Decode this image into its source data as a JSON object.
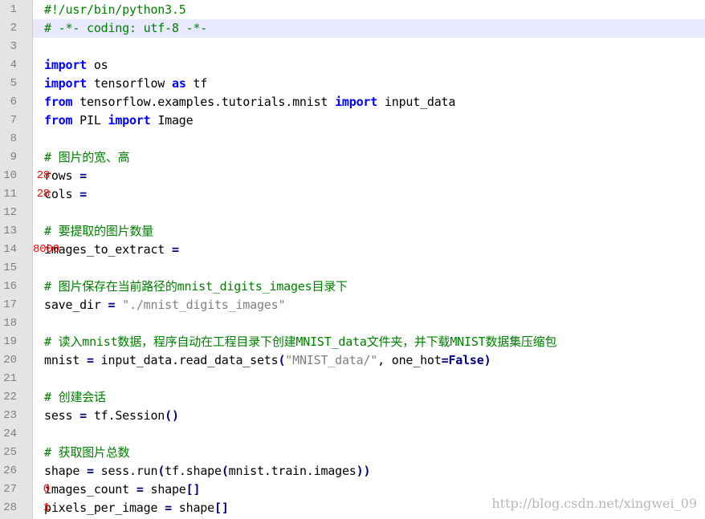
{
  "editor": {
    "lines": [
      {
        "n": "1",
        "tokens": [
          {
            "t": "#!/usr/bin/python3.5",
            "c": "cm"
          }
        ]
      },
      {
        "n": "2",
        "active": true,
        "tokens": [
          {
            "t": "# -*- coding: utf-8 -*-",
            "c": "cm"
          }
        ]
      },
      {
        "n": "3",
        "tokens": []
      },
      {
        "n": "4",
        "tokens": [
          {
            "t": "import",
            "c": "kw"
          },
          {
            "t": " os",
            "c": "id"
          }
        ]
      },
      {
        "n": "5",
        "tokens": [
          {
            "t": "import",
            "c": "kw"
          },
          {
            "t": " tensorflow ",
            "c": "id"
          },
          {
            "t": "as",
            "c": "kw"
          },
          {
            "t": " tf",
            "c": "id"
          }
        ]
      },
      {
        "n": "6",
        "tokens": [
          {
            "t": "from",
            "c": "kw"
          },
          {
            "t": " tensorflow.examples.tutorials.mnist ",
            "c": "id"
          },
          {
            "t": "import",
            "c": "kw"
          },
          {
            "t": " input_data",
            "c": "id"
          }
        ]
      },
      {
        "n": "7",
        "tokens": [
          {
            "t": "from",
            "c": "kw"
          },
          {
            "t": " PIL ",
            "c": "id"
          },
          {
            "t": "import",
            "c": "kw"
          },
          {
            "t": " Image",
            "c": "id"
          }
        ]
      },
      {
        "n": "8",
        "tokens": []
      },
      {
        "n": "9",
        "tokens": [
          {
            "t": "# 图片的宽、高",
            "c": "cm"
          }
        ]
      },
      {
        "n": "10",
        "tokens": [
          {
            "t": "rows ",
            "c": "id"
          },
          {
            "t": "=",
            "c": "op"
          },
          {
            "t": " ",
            "c": "id"
          },
          {
            "t": "28",
            "c": "num"
          }
        ]
      },
      {
        "n": "11",
        "tokens": [
          {
            "t": "cols ",
            "c": "id"
          },
          {
            "t": "=",
            "c": "op"
          },
          {
            "t": " ",
            "c": "id"
          },
          {
            "t": "28",
            "c": "num"
          }
        ]
      },
      {
        "n": "12",
        "tokens": []
      },
      {
        "n": "13",
        "tokens": [
          {
            "t": "# 要提取的图片数量",
            "c": "cm"
          }
        ]
      },
      {
        "n": "14",
        "tokens": [
          {
            "t": "images_to_extract ",
            "c": "id"
          },
          {
            "t": "=",
            "c": "op"
          },
          {
            "t": " ",
            "c": "id"
          },
          {
            "t": "8000",
            "c": "num"
          }
        ]
      },
      {
        "n": "15",
        "tokens": []
      },
      {
        "n": "16",
        "tokens": [
          {
            "t": "# 图片保存在当前路径的mnist_digits_images目录下",
            "c": "cm"
          }
        ]
      },
      {
        "n": "17",
        "tokens": [
          {
            "t": "save_dir ",
            "c": "id"
          },
          {
            "t": "=",
            "c": "op"
          },
          {
            "t": " ",
            "c": "id"
          },
          {
            "t": "\"./mnist_digits_images\"",
            "c": "str"
          }
        ]
      },
      {
        "n": "18",
        "tokens": []
      },
      {
        "n": "19",
        "tokens": [
          {
            "t": "# 读入mnist数据，程序自动在工程目录下创建MNIST_data文件夹，并下载MNIST数据集压缩包",
            "c": "cm"
          }
        ]
      },
      {
        "n": "20",
        "tokens": [
          {
            "t": "mnist ",
            "c": "id"
          },
          {
            "t": "=",
            "c": "op"
          },
          {
            "t": " input_data.read_data_sets",
            "c": "id"
          },
          {
            "t": "(",
            "c": "op"
          },
          {
            "t": "\"MNIST_data/\"",
            "c": "str"
          },
          {
            "t": ", one_hot",
            "c": "id"
          },
          {
            "t": "=",
            "c": "op"
          },
          {
            "t": "False",
            "c": "const"
          },
          {
            "t": ")",
            "c": "op"
          }
        ]
      },
      {
        "n": "21",
        "tokens": []
      },
      {
        "n": "22",
        "tokens": [
          {
            "t": "# 创建会话",
            "c": "cm"
          }
        ]
      },
      {
        "n": "23",
        "tokens": [
          {
            "t": "sess ",
            "c": "id"
          },
          {
            "t": "=",
            "c": "op"
          },
          {
            "t": " tf.Session",
            "c": "id"
          },
          {
            "t": "()",
            "c": "op"
          }
        ]
      },
      {
        "n": "24",
        "tokens": []
      },
      {
        "n": "25",
        "tokens": [
          {
            "t": "# 获取图片总数",
            "c": "cm"
          }
        ]
      },
      {
        "n": "26",
        "tokens": [
          {
            "t": "shape ",
            "c": "id"
          },
          {
            "t": "=",
            "c": "op"
          },
          {
            "t": " sess.run",
            "c": "id"
          },
          {
            "t": "(",
            "c": "op"
          },
          {
            "t": "tf.shape",
            "c": "id"
          },
          {
            "t": "(",
            "c": "op"
          },
          {
            "t": "mnist.train.images",
            "c": "id"
          },
          {
            "t": "))",
            "c": "op"
          }
        ]
      },
      {
        "n": "27",
        "tokens": [
          {
            "t": "images_count ",
            "c": "id"
          },
          {
            "t": "=",
            "c": "op"
          },
          {
            "t": " shape",
            "c": "id"
          },
          {
            "t": "[",
            "c": "op"
          },
          {
            "t": "0",
            "c": "num"
          },
          {
            "t": "]",
            "c": "op"
          }
        ]
      },
      {
        "n": "28",
        "tokens": [
          {
            "t": "pixels_per_image ",
            "c": "id"
          },
          {
            "t": "=",
            "c": "op"
          },
          {
            "t": " shape",
            "c": "id"
          },
          {
            "t": "[",
            "c": "op"
          },
          {
            "t": "1",
            "c": "num"
          },
          {
            "t": "]",
            "c": "op"
          }
        ]
      }
    ]
  },
  "watermark": "http://blog.csdn.net/xingwei_09",
  "colors": {
    "keyword": "#0000ff",
    "comment": "#008000",
    "number": "#ff0000",
    "string": "#808080",
    "operator": "#000080",
    "gutter_bg": "#e4e4e4",
    "active_line_bg": "#e8e8ff"
  }
}
